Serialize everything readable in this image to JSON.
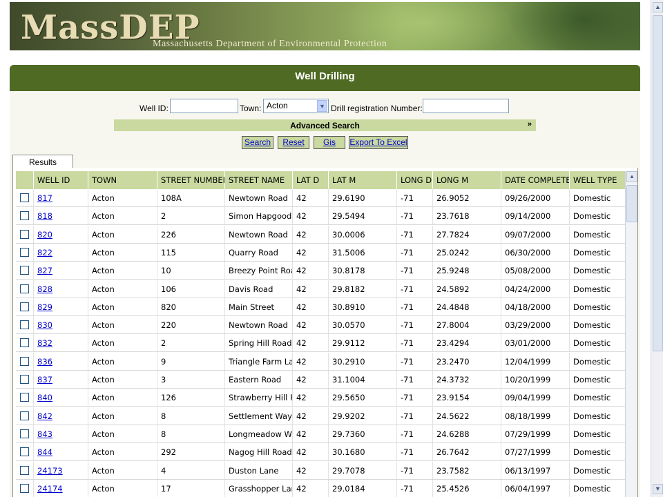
{
  "header": {
    "logo": "MassDEP",
    "subtitle": "Massachusetts Department of Environmental Protection"
  },
  "panel": {
    "title": "Well Drilling"
  },
  "search": {
    "well_id_label": "Well ID:",
    "well_id_value": "",
    "town_label": "Town:",
    "town_value": "Acton",
    "drill_label": "Drill registration Number:",
    "drill_value": ""
  },
  "advanced": {
    "label": "Advanced Search",
    "chevron": "»"
  },
  "buttons": {
    "search": "Search",
    "reset": "Reset",
    "gis": "Gis",
    "export": "Export To Excel"
  },
  "tabs": {
    "results": "Results"
  },
  "table": {
    "columns": [
      "WELL ID",
      "TOWN",
      "STREET NUMBER",
      "STREET NAME",
      "LAT D",
      "LAT M",
      "LONG D",
      "LONG M",
      "DATE COMPLETE",
      "WELL TYPE"
    ],
    "rows": [
      [
        "817",
        "Acton",
        "108A",
        "Newtown Road",
        "42",
        "29.6190",
        "-71",
        "26.9052",
        "09/26/2000",
        "Domestic"
      ],
      [
        "818",
        "Acton",
        "2",
        "Simon Hapgood L",
        "42",
        "29.5494",
        "-71",
        "23.7618",
        "09/14/2000",
        "Domestic"
      ],
      [
        "820",
        "Acton",
        "226",
        "Newtown Road",
        "42",
        "30.0006",
        "-71",
        "27.7824",
        "09/07/2000",
        "Domestic"
      ],
      [
        "822",
        "Acton",
        "115",
        "Quarry Road",
        "42",
        "31.5006",
        "-71",
        "25.0242",
        "06/30/2000",
        "Domestic"
      ],
      [
        "827",
        "Acton",
        "10",
        "Breezy Point Roa",
        "42",
        "30.8178",
        "-71",
        "25.9248",
        "05/08/2000",
        "Domestic"
      ],
      [
        "828",
        "Acton",
        "106",
        "Davis Road",
        "42",
        "29.8182",
        "-71",
        "24.5892",
        "04/24/2000",
        "Domestic"
      ],
      [
        "829",
        "Acton",
        "820",
        "Main Street",
        "42",
        "30.8910",
        "-71",
        "24.4848",
        "04/18/2000",
        "Domestic"
      ],
      [
        "830",
        "Acton",
        "220",
        "Newtown Road",
        "42",
        "30.0570",
        "-71",
        "27.8004",
        "03/29/2000",
        "Domestic"
      ],
      [
        "832",
        "Acton",
        "2",
        "Spring Hill Road",
        "42",
        "29.9112",
        "-71",
        "23.4294",
        "03/01/2000",
        "Domestic"
      ],
      [
        "836",
        "Acton",
        "9",
        "Triangle Farm Lar",
        "42",
        "30.2910",
        "-71",
        "23.2470",
        "12/04/1999",
        "Domestic"
      ],
      [
        "837",
        "Acton",
        "3",
        "Eastern Road",
        "42",
        "31.1004",
        "-71",
        "24.3732",
        "10/20/1999",
        "Domestic"
      ],
      [
        "840",
        "Acton",
        "126",
        "Strawberry Hill Ro",
        "42",
        "29.5650",
        "-71",
        "23.9154",
        "09/04/1999",
        "Domestic"
      ],
      [
        "842",
        "Acton",
        "8",
        "Settlement Way",
        "42",
        "29.9202",
        "-71",
        "24.5622",
        "08/18/1999",
        "Domestic"
      ],
      [
        "843",
        "Acton",
        "8",
        "Longmeadow Way",
        "42",
        "29.7360",
        "-71",
        "24.6288",
        "07/29/1999",
        "Domestic"
      ],
      [
        "844",
        "Acton",
        "292",
        "Nagog Hill Road",
        "42",
        "30.1680",
        "-71",
        "26.7642",
        "07/27/1999",
        "Domestic"
      ],
      [
        "24173",
        "Acton",
        "4",
        "Duston Lane",
        "42",
        "29.7078",
        "-71",
        "23.7582",
        "06/13/1997",
        "Domestic"
      ],
      [
        "24174",
        "Acton",
        "17",
        "Grasshopper Lane",
        "42",
        "29.0184",
        "-71",
        "25.4526",
        "06/04/1997",
        "Domestic"
      ]
    ]
  },
  "icons": {
    "dropdown": "chevron-down-icon",
    "scroll_up": "scroll-up-icon",
    "scroll_down": "scroll-down-icon",
    "checkbox": "checkbox-icon"
  },
  "colors": {
    "panel_header": "#4e6a23",
    "accent_green": "#c9d9a0",
    "link_blue": "#0000cc"
  }
}
